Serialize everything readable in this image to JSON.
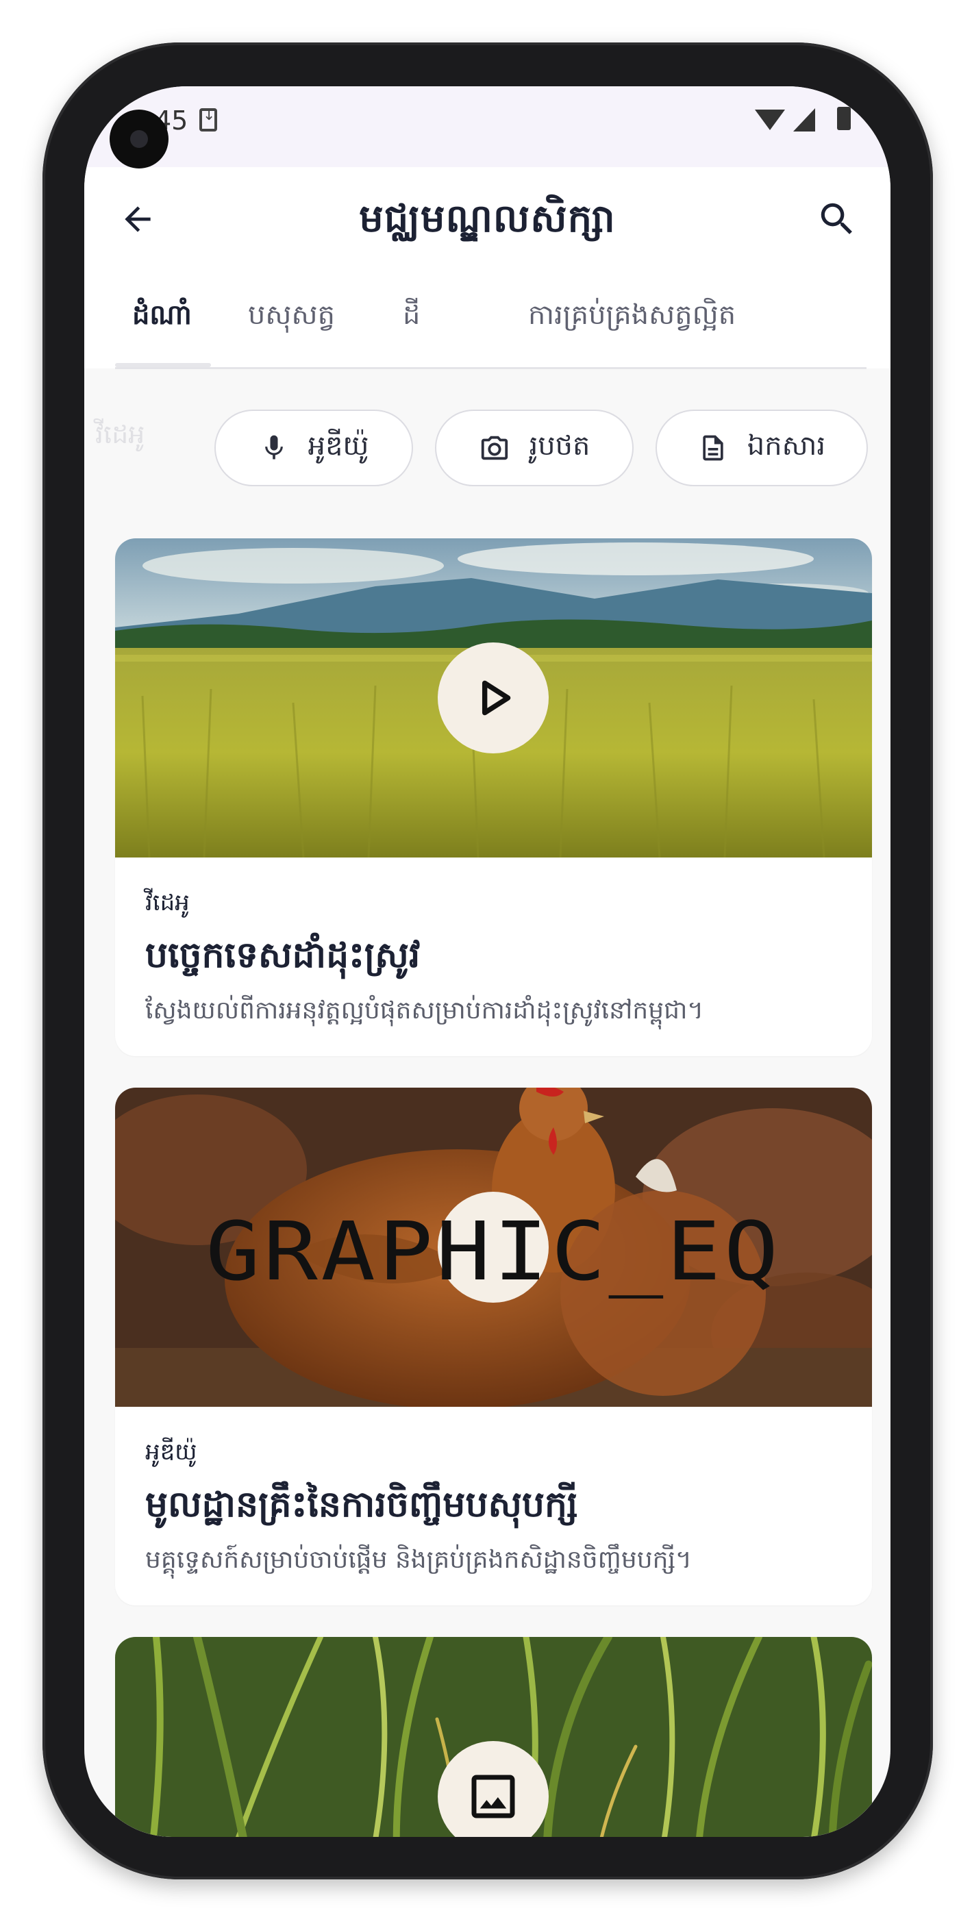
{
  "status_bar": {
    "time": "3:45"
  },
  "app_bar": {
    "title": "មជ្ឈមណ្ឌលសិក្សា",
    "back_icon": "arrow-back-icon",
    "search_icon": "search-icon"
  },
  "tabs": [
    {
      "label": "ដំណាំ",
      "active": true
    },
    {
      "label": "បសុសត្វ",
      "active": false
    },
    {
      "label": "ដី",
      "active": false
    },
    {
      "label": "ការគ្រប់គ្រងសត្វល្អិត",
      "active": false
    }
  ],
  "filters": {
    "partial_chip_label": "វីដេអូ",
    "chips": [
      {
        "label": "អូឌីយ៉ូ",
        "icon": "mic-icon"
      },
      {
        "label": "រូបថត",
        "icon": "camera-icon"
      },
      {
        "label": "ឯកសារ",
        "icon": "document-icon"
      }
    ]
  },
  "cards": [
    {
      "type": "វីដេអូ",
      "title": "បច្ចេកទេសដាំដុះស្រូវ",
      "description": "ស្វែងយល់ពីការអនុវត្តល្អបំផុតសម្រាប់ការដាំដុះស្រូវនៅកម្ពុជា។",
      "media_icon": "play-icon"
    },
    {
      "type": "អូឌីយ៉ូ",
      "title": "មូលដ្ឋានគ្រឹះនៃការចិញ្ចឹមបសុបក្សី",
      "description": "មគ្គុទ្ទេសក៍សម្រាប់ចាប់ផ្តើម និងគ្រប់គ្រងកសិដ្ឋានចិញ្ចឹមបក្សី។",
      "media_icon_text": "GRAPHIC_EQ"
    },
    {
      "media_icon": "image-icon"
    }
  ],
  "colors": {
    "primary_text": "#1c2133",
    "secondary_text": "#5a5d6a",
    "status_bar_bg": "#f6f3fb",
    "screen_bg": "#f8f8f8"
  }
}
